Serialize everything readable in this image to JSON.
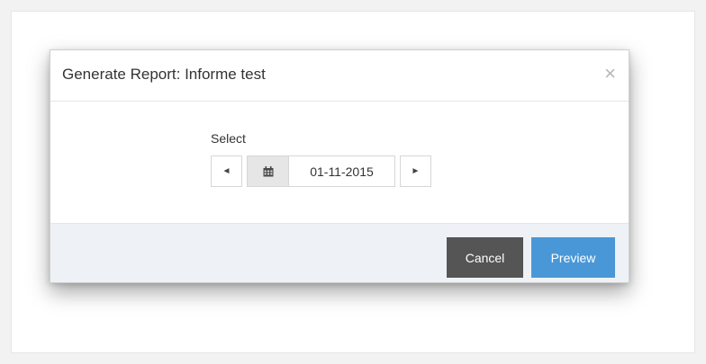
{
  "modal": {
    "title": "Generate Report: Informe test",
    "close_symbol": "×",
    "close_icon": "close-icon"
  },
  "body": {
    "select_label": "Select",
    "prev_symbol": "◄",
    "next_symbol": "►",
    "calendar_icon": "calendar-icon",
    "date_value": "01-11-2015"
  },
  "footer": {
    "cancel_label": "Cancel",
    "preview_label": "Preview"
  },
  "colors": {
    "cancel_bg": "#555555",
    "preview_bg": "#4a97d8",
    "footer_bg": "#eef2f6",
    "calendar_addon_bg": "#e6e6e6"
  }
}
